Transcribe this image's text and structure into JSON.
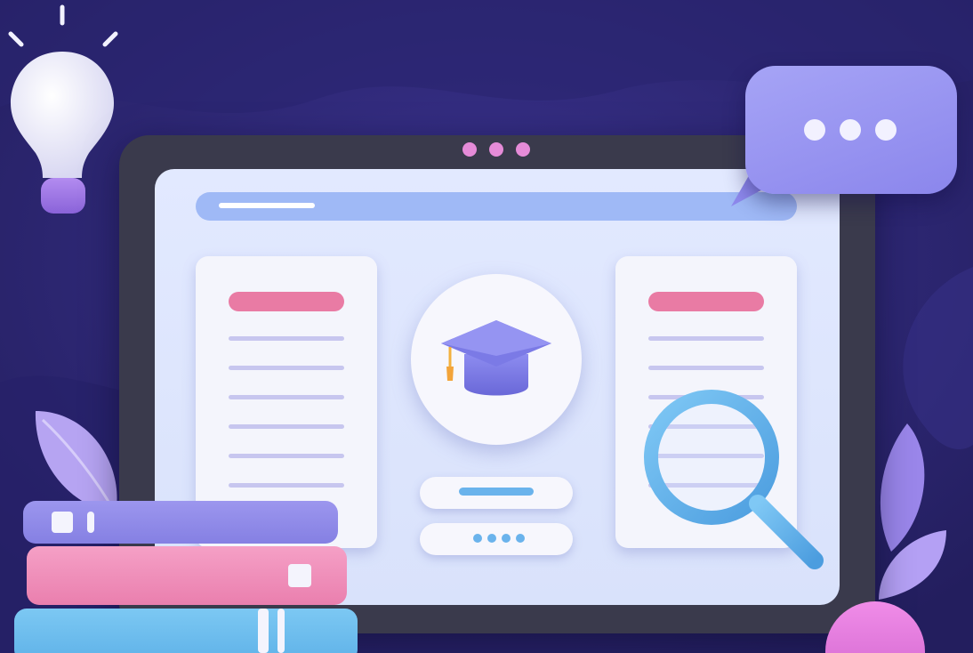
{
  "scene": {
    "description_icons": [
      "lightbulb-icon",
      "graduation-cap-icon",
      "magnifier-icon",
      "chat-bubble-icon",
      "books-icon",
      "leaf-icon"
    ],
    "colors": {
      "background": "#2e2873",
      "monitor_frame": "#3a3a4c",
      "screen": "#e2e9ff",
      "accent_pink": "#e97ba4",
      "accent_blue": "#6ab3ec",
      "accent_purple": "#8b86ec"
    }
  }
}
